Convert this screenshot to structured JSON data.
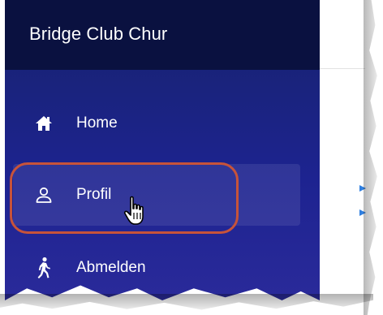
{
  "app": {
    "title": "Bridge Club Chur"
  },
  "nav": {
    "items": [
      {
        "label": "Home",
        "icon": "home-icon"
      },
      {
        "label": "Profil",
        "icon": "user-icon",
        "active": true
      },
      {
        "label": "Abmelden",
        "icon": "walking-person-icon"
      }
    ]
  },
  "colors": {
    "sidebar": "#1a237e",
    "brand_bar": "#0a1140",
    "highlight_ring": "#c7533a",
    "marker": "#2f7fe0"
  }
}
